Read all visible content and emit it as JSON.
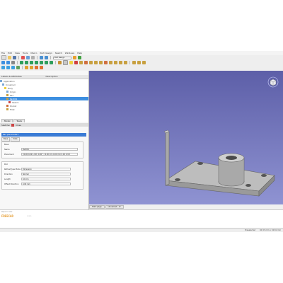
{
  "menu": [
    "File",
    "Edit",
    "View",
    "Tools",
    "Macro",
    "Part Design",
    "Sketch",
    "Windows",
    "Help"
  ],
  "toolbar": {
    "workbench": "Part Design"
  },
  "combo_view": {
    "tree_headers": [
      "Labels & Attributes",
      "Description"
    ],
    "tree_items": [
      "Application",
      "Unnamed",
      "Body",
      "Origin",
      "Pad",
      "Sketch",
      "Pocket",
      "Pad001",
      "Fillet"
    ],
    "selected_item": "Pad001"
  },
  "panel_tabs": [
    "Model",
    "Tasks"
  ],
  "task": {
    "header_label": "Sketcher",
    "close_label": "Close",
    "title": "Pad parameters",
    "subtabs": [
      "Base",
      "Data"
    ],
    "base_group": "Base",
    "name_label": "Name",
    "name_value": "Pad001",
    "placement_label": "Placement",
    "placement_value": "[(0.00 0.00 1.00); 0.00 °; (0.00 mm 0.00 mm 0.00 mm)]",
    "pad_group": "Pad",
    "fields": [
      {
        "label": "Refine/Type Mode",
        "value": "Dimension"
      },
      {
        "label": "Direction",
        "value": "Normal"
      },
      {
        "label": "Length",
        "value": "10 mm"
      },
      {
        "label": "Offset Direction",
        "value": "0.00 mm"
      }
    ]
  },
  "view_tabs": [
    "Start page",
    "Unnamed : 1*"
  ],
  "report": {
    "line1": "Report view",
    "brand": "FREECAD",
    "prompt": ">>> "
  },
  "status": {
    "left": "Preselected",
    "dims": "61.53 mm x 34.81 mm"
  },
  "colors": {
    "view_top": "#5d5fa8",
    "view_bottom": "#8f93d2",
    "selection": "#3d8fe0",
    "part": "#c8c8c8"
  }
}
